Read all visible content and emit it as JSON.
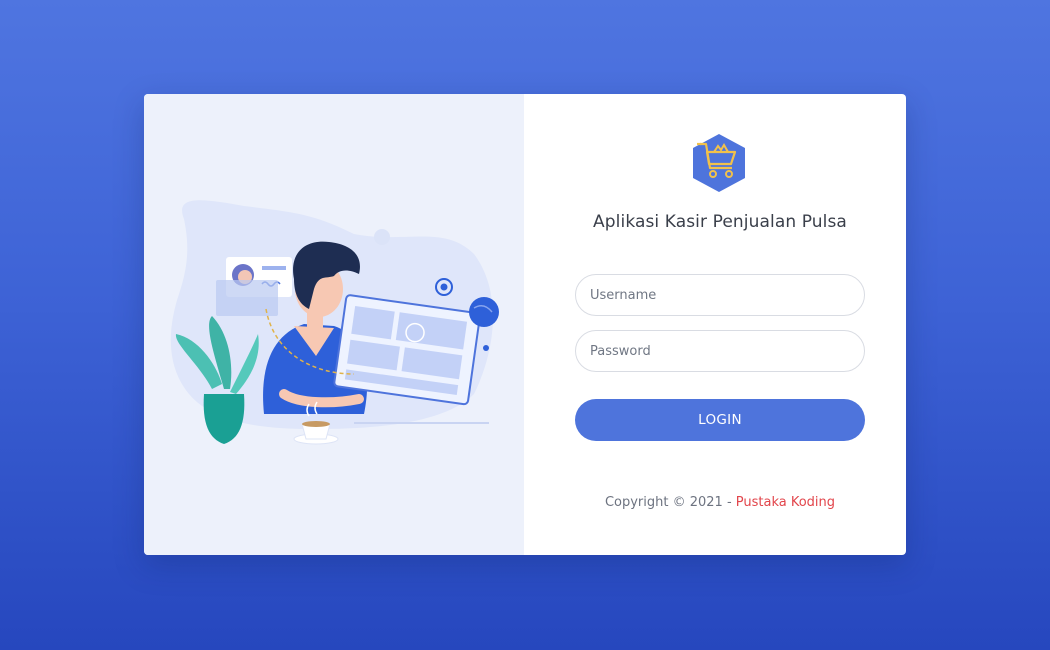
{
  "login": {
    "app_title": "Aplikasi Kasir Penjualan Pulsa",
    "username_placeholder": "Username",
    "password_placeholder": "Password",
    "login_label": "LOGIN"
  },
  "footer": {
    "copyright_prefix": "Copyright © 2021 - ",
    "brand": "Pustaka Koding"
  },
  "icons": {
    "logo": "shopping-cart-hexagon-icon",
    "illustration": "person-working-on-tablet-illustration"
  },
  "colors": {
    "background_top": "#4f75e0",
    "background_bottom": "#2647be",
    "primary": "#4e74dc",
    "brand_link": "#e2454b",
    "illustration_panel": "#edf1fb",
    "logo_fill": "#4e74dc",
    "logo_stroke": "#f1c14b"
  }
}
